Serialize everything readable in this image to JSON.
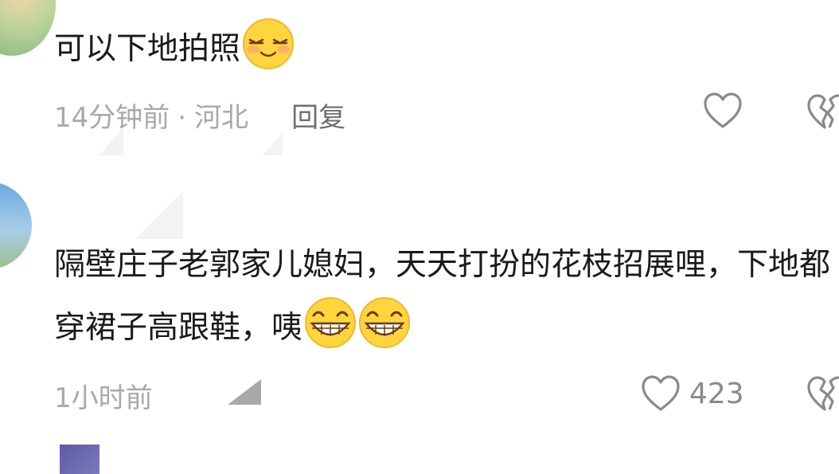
{
  "comments": [
    {
      "text": "可以下地拍照",
      "emoji_names": [
        "smiling-eyes-closed-emoji"
      ],
      "time": "14分钟前",
      "location": "河北",
      "reply_label": "回复",
      "like_count": ""
    },
    {
      "text": "隔壁庄子老郭家儿媳妇，天天打扮的花枝招展哩，下地都穿裙子高跟鞋，咦",
      "emoji_names": [
        "grinning-emoji",
        "grinning-emoji"
      ],
      "time": "1小时前",
      "location": "",
      "reply_label": "",
      "like_count": "423"
    }
  ],
  "meta_separator": "·",
  "icons": {
    "like": "heart-outline-icon",
    "dislike": "broken-heart-icon"
  },
  "colors": {
    "text": "#1a1a1a",
    "meta": "#a9a9a9",
    "reply": "#6e6e6e",
    "icon": "#8a8a8a"
  }
}
